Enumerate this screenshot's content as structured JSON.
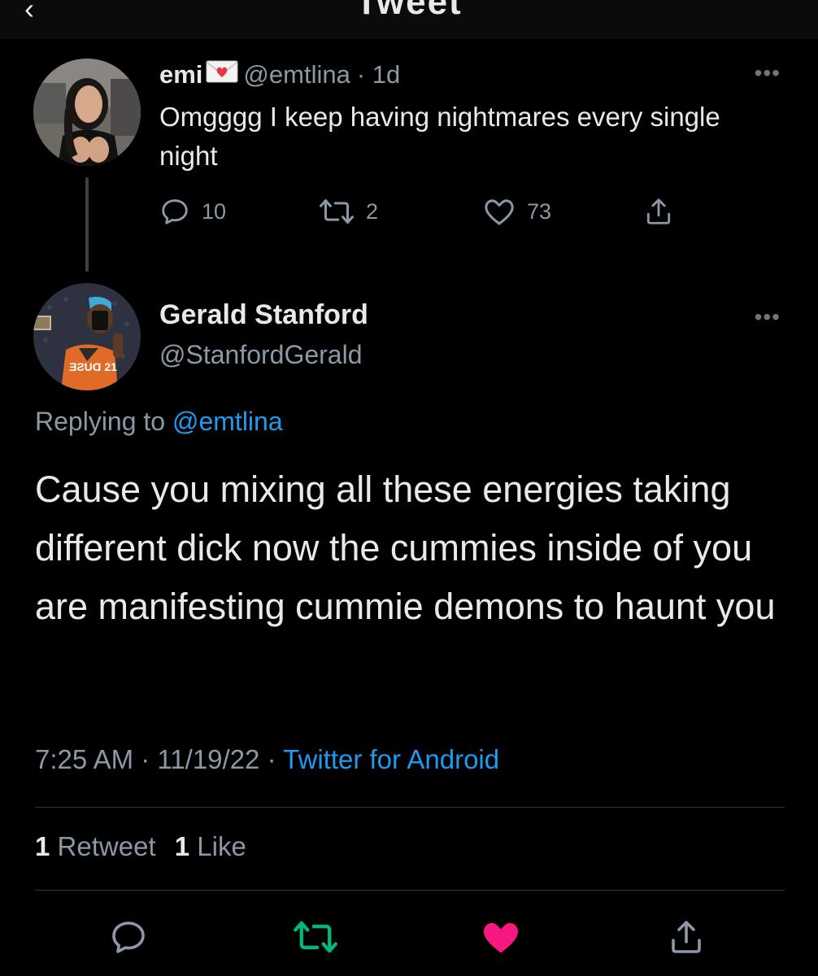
{
  "header": {
    "title": "Tweet"
  },
  "parent_tweet": {
    "name": "emi",
    "handle": "@emtlina",
    "time": "· 1d",
    "text": "Omgggg I keep having nightmares every single night",
    "replies": "10",
    "retweets": "2",
    "likes": "73",
    "icons": [
      "reply-icon",
      "retweet-icon",
      "like-icon",
      "share-icon",
      "love-letter-emoji",
      "more-icon"
    ]
  },
  "main_tweet": {
    "name": "Gerald Stanford",
    "handle": "@StanfordGerald",
    "replying_prefix": "Replying to",
    "replying_to": "@emtlina",
    "text": "Cause you mixing all these energies taking different dick now the cummies inside of you are manifesting cummie demons to haunt you",
    "time": "7:25 AM · 11/19/22 ·",
    "source": "Twitter for Android",
    "retweet_count": "1",
    "retweet_label": "Retweet",
    "like_count": "1",
    "like_label": "Like",
    "jersey_text": "ƎƧUⱭ 21"
  },
  "colors": {
    "background": "#000000",
    "text": "#e7e9ea",
    "secondary": "#8b98a5",
    "link": "#1d9bf0",
    "retweet_green": "#00ba7c",
    "like_pink": "#f91880"
  }
}
